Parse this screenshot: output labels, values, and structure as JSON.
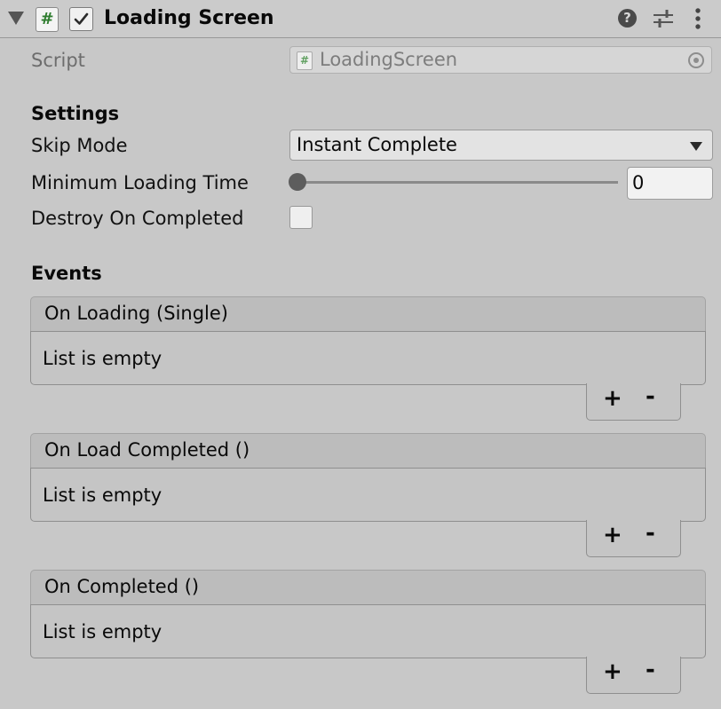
{
  "header": {
    "title": "Loading Screen",
    "script_glyph": "#",
    "enabled": true,
    "icons": [
      "foldout-triangle-icon",
      "script-icon",
      "checkbox-check-icon",
      "help-icon",
      "presets-sliders-icon",
      "more-vertical-icon"
    ]
  },
  "script": {
    "label": "Script",
    "value": "LoadingScreen",
    "glyph": "#"
  },
  "settings": {
    "title": "Settings",
    "skip_mode": {
      "label": "Skip Mode",
      "value": "Instant Complete"
    },
    "min_loading_time": {
      "label": "Minimum Loading Time",
      "value": "0",
      "slider_fraction": 0
    },
    "destroy_on_completed": {
      "label": "Destroy On Completed",
      "checked": false
    }
  },
  "events": {
    "title": "Events",
    "list": [
      {
        "name": "On Loading (Single)",
        "empty_text": "List is empty",
        "plus": "+",
        "minus": "-"
      },
      {
        "name": "On Load Completed ()",
        "empty_text": "List is empty",
        "plus": "+",
        "minus": "-"
      },
      {
        "name": "On Completed ()",
        "empty_text": "List is empty",
        "plus": "+",
        "minus": "-"
      }
    ]
  }
}
